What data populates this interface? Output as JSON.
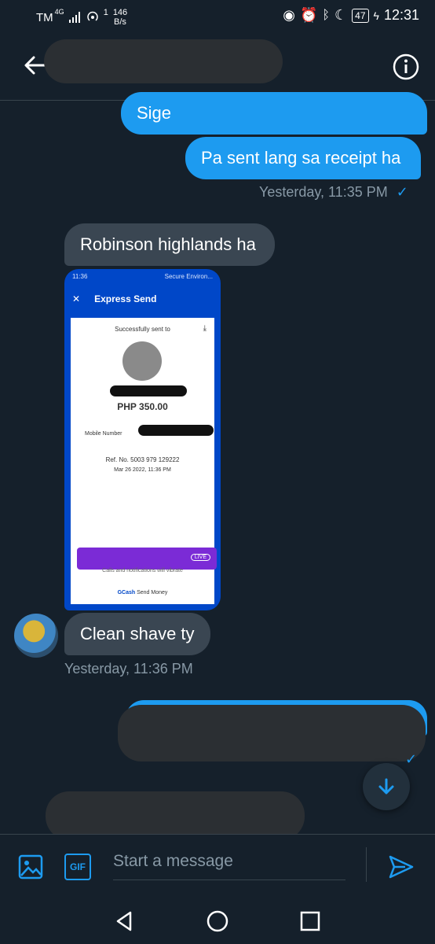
{
  "status_bar": {
    "carrier": "TM",
    "network": "4G",
    "data_speed_value": "146",
    "data_speed_unit": "B/s",
    "data_prefix": "1",
    "battery": "47",
    "time": "12:31"
  },
  "header": {
    "back_icon": "back-arrow-icon",
    "info_icon": "info-icon"
  },
  "messages": [
    {
      "text": "Sige"
    },
    {
      "text": "Pa sent lang sa receipt ha"
    },
    {
      "meta": "Yesterday, 11:35 PM"
    },
    {
      "text": "Robinson highlands ha"
    },
    {
      "text": "Clean shave ty"
    },
    {
      "meta": "Yesterday, 11:36 PM"
    }
  ],
  "receipt": {
    "status_time": "11:36",
    "status_label": "Secure Environ...",
    "title": "Express Send",
    "sent_to": "Successfully sent to",
    "amount": "PHP 350.00",
    "mobile_label": "Mobile Number",
    "ref": "Ref. No. 5003 979 129222",
    "date": "Mar 26 2022, 11:36 PM",
    "promo_live": "LIVE",
    "toast": "Calls and notifications will vibrate",
    "footer_brand": "GCash",
    "footer_text": "Send Money"
  },
  "composer": {
    "placeholder": "Start a message",
    "gif_label": "GIF"
  },
  "colors": {
    "background": "#15202b",
    "outgoing_bubble": "#1d9bf0",
    "incoming_bubble": "#3a4652",
    "meta_text": "#8899a6",
    "gcash_blue": "#0047c8"
  }
}
